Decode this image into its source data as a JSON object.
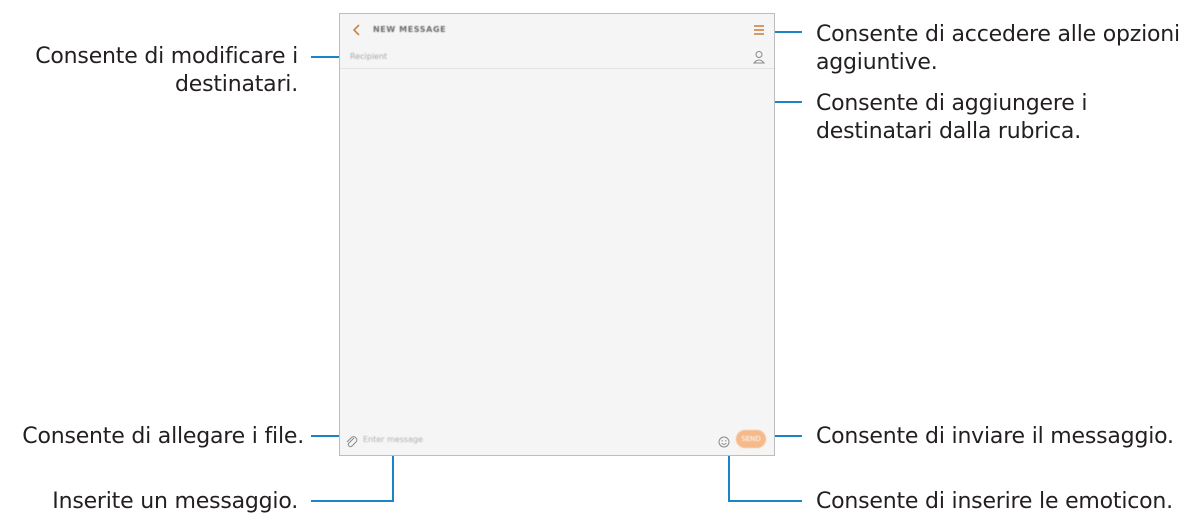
{
  "screen": {
    "appbar": {
      "title": "NEW MESSAGE"
    },
    "recipient_placeholder": "Recipient",
    "compose": {
      "placeholder": "Enter message",
      "send_label": "SEND"
    }
  },
  "callouts": {
    "edit_recipients": [
      "Consente di modificare i",
      "destinatari."
    ],
    "attach_files": "Consente di allegare i file.",
    "enter_message": "Inserite un messaggio.",
    "more_options": [
      "Consente di accedere alle opzioni",
      "aggiuntive."
    ],
    "add_from_contacts": [
      "Consente di aggiungere i",
      "destinatari dalla rubrica."
    ],
    "send_message": "Consente di inviare il messaggio.",
    "insert_emoticons": "Consente di inserire le emoticon."
  },
  "icons": {
    "back": "chevron-left-icon",
    "menu": "more-options-icon",
    "contacts": "contact-person-icon",
    "attach": "paperclip-icon",
    "emoji": "smiley-icon"
  },
  "colors": {
    "accent": "#c7864b",
    "send_button": "#f5b98a",
    "leader_line": "#1a85c5"
  }
}
